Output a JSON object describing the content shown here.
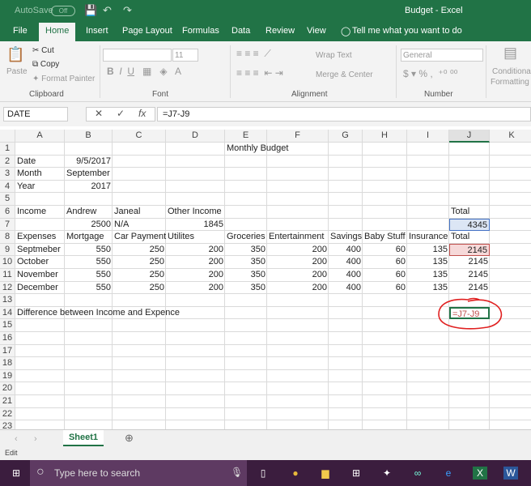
{
  "titlebar": {
    "autosave": "AutoSave",
    "autosave_state": "Off",
    "title": "Budget  -  Excel"
  },
  "tabs": [
    "File",
    "Home",
    "Insert",
    "Page Layout",
    "Formulas",
    "Data",
    "Review",
    "View"
  ],
  "tell_me": "Tell me what you want to do",
  "ribbon": {
    "paste": "Paste",
    "cut": "Cut",
    "copy": "Copy",
    "format_painter": "Format Painter",
    "clipboard": "Clipboard",
    "font_size": "11",
    "font": "Font",
    "wrap_text": "Wrap Text",
    "merge_center": "Merge & Center",
    "alignment": "Alignment",
    "number_format": "General",
    "number": "Number",
    "conditional": "Conditional",
    "formatting": "Formatting"
  },
  "formula_bar": {
    "name_box": "DATE",
    "formula": "=J7-J9"
  },
  "columns": [
    "A",
    "B",
    "C",
    "D",
    "E",
    "F",
    "G",
    "H",
    "I",
    "J",
    "K"
  ],
  "cells": [
    {
      "ref": "E1",
      "v": "Monthly Budget",
      "align": "center"
    },
    {
      "ref": "A2",
      "v": "Date"
    },
    {
      "ref": "B2",
      "v": "9/5/2017",
      "num": true
    },
    {
      "ref": "A3",
      "v": "Month"
    },
    {
      "ref": "B3",
      "v": "September"
    },
    {
      "ref": "A4",
      "v": "Year"
    },
    {
      "ref": "B4",
      "v": "2017",
      "num": true
    },
    {
      "ref": "A6",
      "v": "Income"
    },
    {
      "ref": "B6",
      "v": "Andrew"
    },
    {
      "ref": "C6",
      "v": "Janeal"
    },
    {
      "ref": "D6",
      "v": "Other Income"
    },
    {
      "ref": "J6",
      "v": "Total"
    },
    {
      "ref": "B7",
      "v": "2500",
      "num": true
    },
    {
      "ref": "C7",
      "v": "N/A"
    },
    {
      "ref": "D7",
      "v": "1845",
      "num": true
    },
    {
      "ref": "J7",
      "v": "4345",
      "num": true
    },
    {
      "ref": "A8",
      "v": "Expenses"
    },
    {
      "ref": "B8",
      "v": "Mortgage"
    },
    {
      "ref": "C8",
      "v": "Car Payment"
    },
    {
      "ref": "D8",
      "v": "Utilites"
    },
    {
      "ref": "E8",
      "v": "Groceries"
    },
    {
      "ref": "F8",
      "v": "Entertainment"
    },
    {
      "ref": "G8",
      "v": "Savings"
    },
    {
      "ref": "H8",
      "v": "Baby Stuff"
    },
    {
      "ref": "I8",
      "v": "Insurance"
    },
    {
      "ref": "J8",
      "v": "Total"
    },
    {
      "ref": "A9",
      "v": "Septmeber"
    },
    {
      "ref": "A10",
      "v": "October"
    },
    {
      "ref": "A11",
      "v": "November"
    },
    {
      "ref": "A12",
      "v": "December"
    },
    {
      "ref": "A14",
      "v": "Difference between Income and Expence"
    },
    {
      "ref": "J14",
      "v": "=J7-J9"
    }
  ],
  "expense_rows": [
    [
      "550",
      "250",
      "200",
      "350",
      "200",
      "400",
      "60",
      "135",
      "2145"
    ],
    [
      "550",
      "250",
      "200",
      "350",
      "200",
      "400",
      "60",
      "135",
      "2145"
    ],
    [
      "550",
      "250",
      "200",
      "350",
      "200",
      "400",
      "60",
      "135",
      "2145"
    ],
    [
      "550",
      "250",
      "200",
      "350",
      "200",
      "400",
      "60",
      "135",
      "2145"
    ]
  ],
  "sheet_tab": "Sheet1",
  "status": "Edit",
  "taskbar": {
    "search_placeholder": "Type here to search"
  },
  "colors": {
    "excel_green": "#217346",
    "ref_blue": "#4472c4",
    "ref_red": "#c0504d",
    "annotation": "#e02020"
  }
}
